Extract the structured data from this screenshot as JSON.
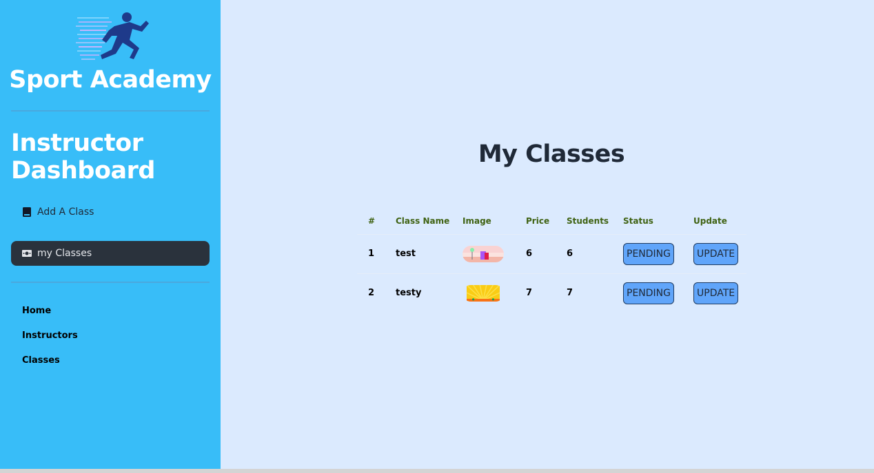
{
  "sidebar": {
    "brand": "Sport Academy",
    "logo_icon": "runner-logo",
    "dashboard_title_line1": "Instructor",
    "dashboard_title_line2": "Dashboard",
    "menu": [
      {
        "label": "Add A Class",
        "icon": "book-icon",
        "active": false
      },
      {
        "label": "my Classes",
        "icon": "money-icon",
        "active": true
      }
    ],
    "nav": [
      {
        "label": "Home"
      },
      {
        "label": "Instructors"
      },
      {
        "label": "Classes"
      }
    ],
    "colors": {
      "background": "#38bdf8",
      "active_item": "#2a323c"
    }
  },
  "main": {
    "title": "My Classes",
    "table": {
      "headers": [
        "#",
        "Class Name",
        "Image",
        "Price",
        "Students",
        "Status",
        "Update"
      ],
      "rows": [
        {
          "index": "1",
          "name": "test",
          "image": "landscape-thumbnail",
          "price": "6",
          "students": "6",
          "status": "PENDING",
          "update": "UPDATE"
        },
        {
          "index": "2",
          "name": "testy",
          "image": "sunburst-thumbnail",
          "price": "7",
          "students": "7",
          "status": "PENDING",
          "update": "UPDATE"
        }
      ]
    },
    "colors": {
      "background": "#dbeafe",
      "header_text": "#3f6212",
      "button": "#60a5fa"
    }
  }
}
